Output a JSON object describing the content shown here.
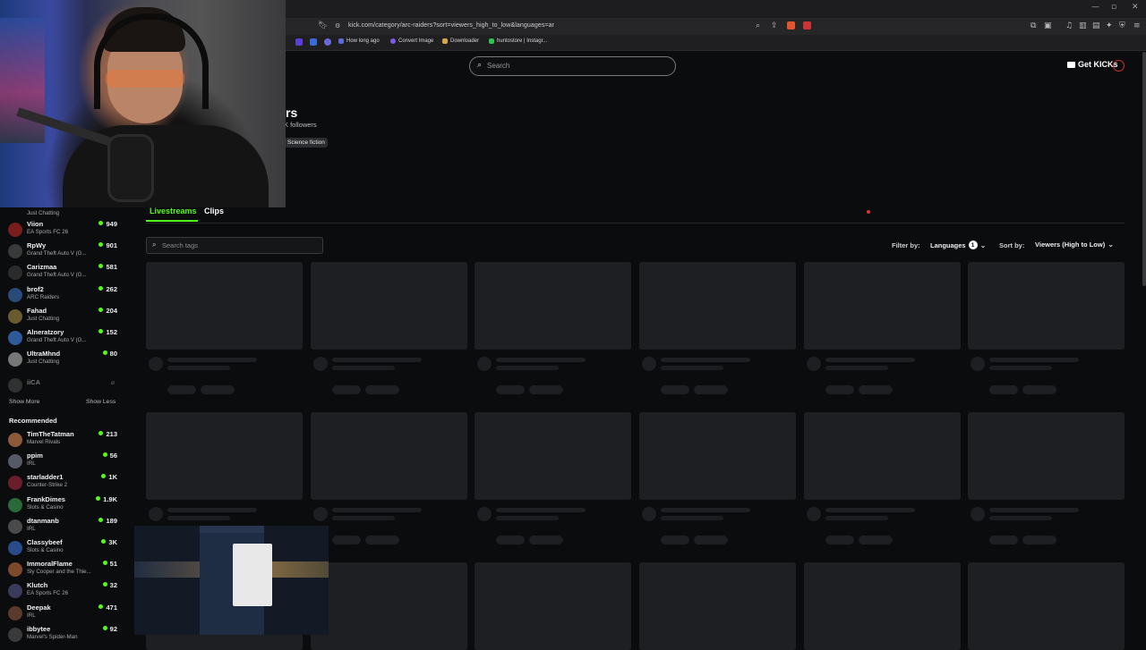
{
  "browser": {
    "url": "kick.com/category/arc-raiders?sort=viewers_high_to_low&languages=ar",
    "bookmarks": [
      "How long ago",
      "Convert Image",
      "Downloader",
      "huntostore | Instagr..."
    ]
  },
  "header": {
    "search_placeholder": "Search",
    "get_kicks_label": "Get KICKs"
  },
  "category": {
    "title_partial": "rs",
    "followers_partial": "K followers",
    "tag": "Science fiction"
  },
  "tabs": [
    {
      "label": "Livestreams",
      "active": true
    },
    {
      "label": "Clips",
      "active": false
    }
  ],
  "controls": {
    "tag_search_placeholder": "Search tags",
    "filter_label": "Filter by:",
    "languages_label": "Languages",
    "languages_count": "1",
    "sort_label": "Sort by:",
    "sort_value": "Viewers (High to Low)"
  },
  "sidebar": {
    "top_game": "Just Chatting",
    "following": [
      {
        "name": "Viion",
        "game": "EA Sports FC 26",
        "viewers": "949",
        "color": "#7a1d1d"
      },
      {
        "name": "RpWy",
        "game": "Grand Theft Auto V (G...",
        "viewers": "901",
        "color": "#3a3a3a"
      },
      {
        "name": "Carizmaa",
        "game": "Grand Theft Auto V (G...",
        "viewers": "581",
        "color": "#2b2b2b"
      },
      {
        "name": "brof2",
        "game": "ARC Raiders",
        "viewers": "262",
        "color": "#2a4a7a"
      },
      {
        "name": "Fahad",
        "game": "Just Chatting",
        "viewers": "204",
        "color": "#6a5a30"
      },
      {
        "name": "Alneratzory",
        "game": "Grand Theft Auto V (G...",
        "viewers": "152",
        "color": "#2f5a9a"
      },
      {
        "name": "UltraMhnd",
        "game": "Just Chatting",
        "viewers": "80",
        "color": "#777"
      }
    ],
    "offline_item": "iiCA",
    "show_more": "Show More",
    "show_less": "Show Less",
    "recommended_title": "Recommended",
    "recommended": [
      {
        "name": "TimTheTatman",
        "game": "Marvel Rivals",
        "viewers": "213",
        "color": "#8a5a3a"
      },
      {
        "name": "ppim",
        "game": "IRL",
        "viewers": "56",
        "color": "#555a66"
      },
      {
        "name": "starladder1",
        "game": "Counter-Strike 2",
        "viewers": "1K",
        "color": "#6a1d2a"
      },
      {
        "name": "FrankDimes",
        "game": "Slots & Casino",
        "viewers": "1.9K",
        "color": "#2a6a3a"
      },
      {
        "name": "dtanmanb",
        "game": "IRL",
        "viewers": "189",
        "color": "#4a4a4a"
      },
      {
        "name": "Classybeef",
        "game": "Slots & Casino",
        "viewers": "3K",
        "color": "#2a4a8a"
      },
      {
        "name": "ImmoralFlame",
        "game": "Sly Cooper and the Thie...",
        "viewers": "51",
        "color": "#7a4a2a"
      },
      {
        "name": "Klutch",
        "game": "EA Sports FC 26",
        "viewers": "32",
        "color": "#3a3a5a"
      },
      {
        "name": "Deepak",
        "game": "IRL",
        "viewers": "471",
        "color": "#5a3a2a"
      },
      {
        "name": "ibbytee",
        "game": "Marvel's Spider-Man",
        "viewers": "92",
        "color": "#3a3a3a"
      }
    ]
  },
  "colors": {
    "accent": "#53fc18",
    "background": "#0b0c0d",
    "skeleton": "#1e1f22"
  }
}
